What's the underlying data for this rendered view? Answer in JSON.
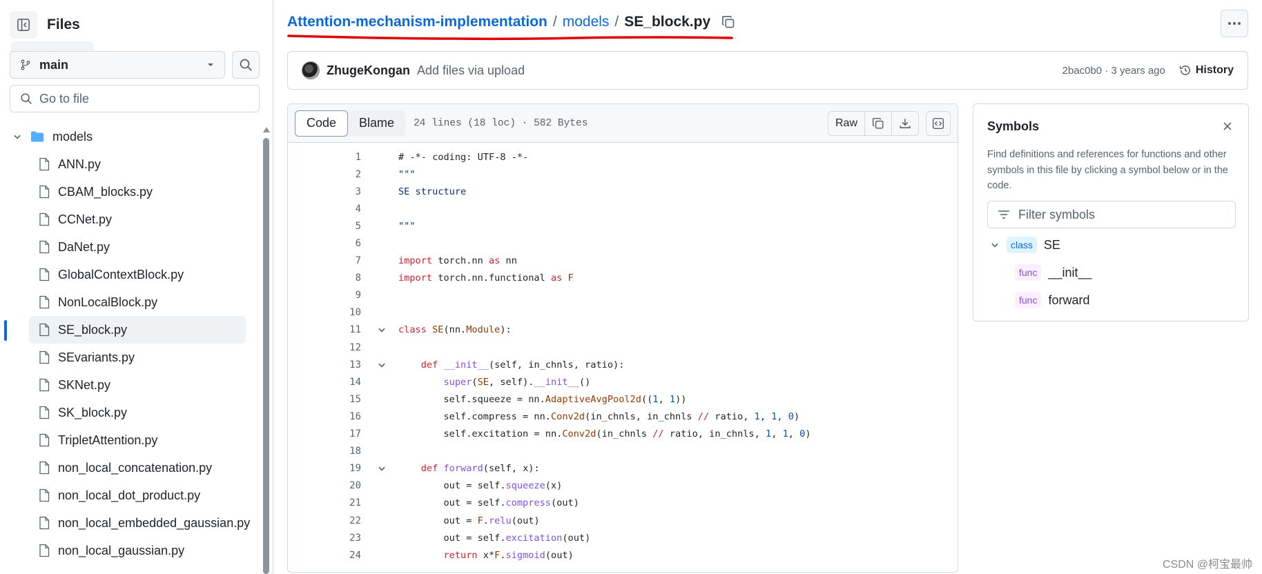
{
  "sidebar": {
    "title": "Files",
    "branch": "main",
    "goto_placeholder": "Go to file",
    "folder": "models",
    "files": [
      "ANN.py",
      "CBAM_blocks.py",
      "CCNet.py",
      "DaNet.py",
      "GlobalContextBlock.py",
      "NonLocalBlock.py",
      "SE_block.py",
      "SEvariants.py",
      "SKNet.py",
      "SK_block.py",
      "TripletAttention.py",
      "non_local_concatenation.py",
      "non_local_dot_product.py",
      "non_local_embedded_gaussian.py",
      "non_local_gaussian.py"
    ],
    "active_file": "SE_block.py"
  },
  "breadcrumb": {
    "repo": "Attention-mechanism-implementation",
    "sep": "/",
    "folder": "models",
    "file": "SE_block.py"
  },
  "commit": {
    "author": "ZhugeKongan",
    "message": "Add files via upload",
    "meta": "2bac0b0 · 3 years ago",
    "history_label": "History"
  },
  "code_header": {
    "tab_code": "Code",
    "tab_blame": "Blame",
    "info": "24 lines (18 loc) · 582 Bytes",
    "raw": "Raw"
  },
  "code": {
    "line_numbers": [
      "1",
      "2",
      "3",
      "4",
      "5",
      "6",
      "7",
      "8",
      "9",
      "10",
      "11",
      "12",
      "13",
      "14",
      "15",
      "16",
      "17",
      "18",
      "19",
      "20",
      "21",
      "22",
      "23",
      "24"
    ]
  },
  "symbols": {
    "title": "Symbols",
    "description": "Find definitions and references for functions and other symbols in this file by clicking a symbol below or in the code.",
    "filter_placeholder": "Filter symbols",
    "items": [
      {
        "kind": "class",
        "name": "SE"
      },
      {
        "kind": "func",
        "name": "__init__"
      },
      {
        "kind": "func",
        "name": "forward"
      }
    ]
  },
  "watermark": "CSDN @柯宝最帅",
  "colors": {
    "link": "#0969da",
    "annotation_underline": "#e00000",
    "active_indicator": "#0969da"
  }
}
